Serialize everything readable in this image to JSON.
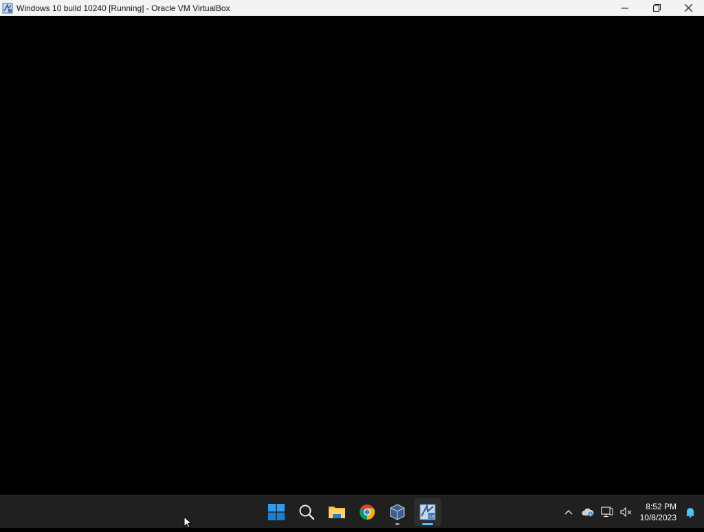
{
  "window": {
    "title": "Windows 10 build 10240 [Running] - Oracle VM VirtualBox",
    "controls": {
      "minimize": "minimize-icon",
      "maximize": "restore-icon",
      "close": "close-icon"
    }
  },
  "taskbar": {
    "apps": [
      {
        "name": "start",
        "icon": "windows-logo-icon"
      },
      {
        "name": "search",
        "icon": "search-icon"
      },
      {
        "name": "file-explorer",
        "icon": "folder-icon"
      },
      {
        "name": "chrome",
        "icon": "chrome-icon"
      },
      {
        "name": "virtualbox-manager",
        "icon": "virtualbox-icon"
      },
      {
        "name": "virtualbox-vm",
        "icon": "vm-window-icon"
      }
    ],
    "tray": {
      "time": "8:52 PM",
      "date": "10/8/2023"
    }
  },
  "colors": {
    "titlebar_bg": "#f3f3f3",
    "screen_bg": "#000000",
    "taskbar_bg": "#202020",
    "accent": "#4cc2ff"
  }
}
